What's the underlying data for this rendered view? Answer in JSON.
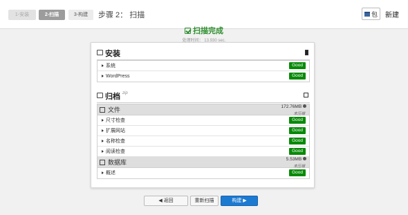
{
  "header": {
    "steps": [
      "1-安装",
      "2-扫描",
      "3-构建"
    ],
    "title": "步骤 2： 扫描",
    "package_label": "包",
    "new_label": "新建"
  },
  "status": {
    "title": "扫描完成",
    "time": "处理时间： 13.930 sec."
  },
  "install": {
    "title": "安装",
    "rows": [
      {
        "label": "系统",
        "status": "Good"
      },
      {
        "label": "WordPress",
        "status": "Good"
      }
    ]
  },
  "archive": {
    "title": "归档",
    "format": "zip",
    "files": {
      "title": "文件",
      "size": "172.76MB",
      "note": "未压缩",
      "rows": [
        {
          "label": "尺寸检查",
          "status": "Good"
        },
        {
          "label": "扩展网站",
          "status": "Good"
        },
        {
          "label": "名称检查",
          "status": "Good"
        },
        {
          "label": "阅读检查",
          "status": "Good"
        }
      ]
    },
    "database": {
      "title": "数据库",
      "size": "5.53MB",
      "note": "未压缩",
      "rows": [
        {
          "label": "概述",
          "status": "Good"
        }
      ]
    }
  },
  "footer": {
    "back": "◀ 返回",
    "rescan": "重新扫描",
    "build": "构建 ▶"
  },
  "colors": {
    "good": "#078a07",
    "success_text": "#2d8e2d",
    "primary": "#1d7ad1"
  }
}
